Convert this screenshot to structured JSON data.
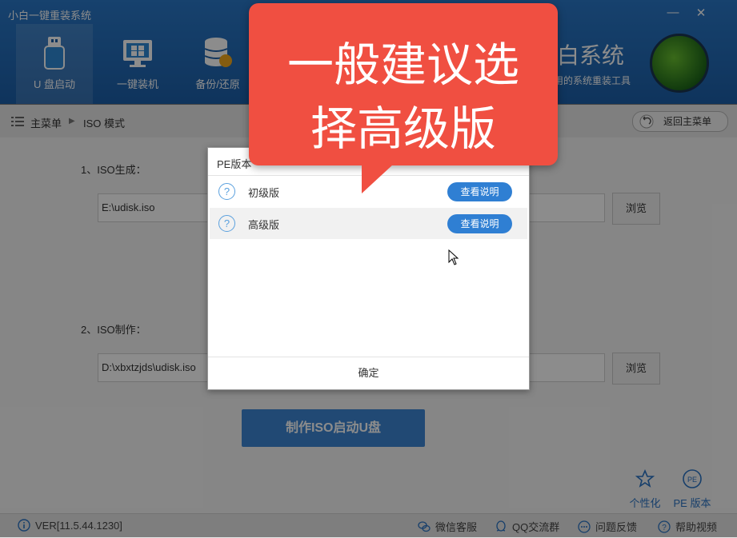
{
  "window": {
    "title": "小白一键重装系统",
    "min_glyph": "—",
    "close_glyph": "✕"
  },
  "nav": [
    {
      "label": "U 盘启动"
    },
    {
      "label": "一键装机"
    },
    {
      "label": "备份/还原"
    }
  ],
  "brand": {
    "name": "白系统",
    "tagline": "用的系统重装工具"
  },
  "breadcrumb": {
    "home": "主菜单",
    "separator": "▶",
    "current": "ISO 模式",
    "back_label": "返回主菜单"
  },
  "main": {
    "section1_label": "1、ISO生成：",
    "iso_output_path": "E:\\udisk.iso",
    "section2_label": "2、ISO制作：",
    "iso_source_path": "D:\\xbxtzjds\\udisk.iso",
    "browse_label": "浏览",
    "make_button": "制作ISO启动U盘"
  },
  "tools": [
    {
      "label": "个性化",
      "icon": "customize-icon"
    },
    {
      "label": "PE 版本",
      "icon": "pe-version-icon"
    }
  ],
  "footer": {
    "version": "VER[11.5.44.1230]",
    "wechat": "微信客服",
    "qq": "QQ交流群",
    "feedback": "问题反馈",
    "help_video": "帮助视频"
  },
  "dialog": {
    "title": "PE版本",
    "options": [
      {
        "name": "初级版",
        "detail": "查看说明"
      },
      {
        "name": "高级版",
        "detail": "查看说明"
      }
    ],
    "confirm": "确定"
  },
  "callout": {
    "line1": "一般建议选",
    "line2": "择高级版"
  },
  "colors": {
    "header_blue": "#1c5fa8",
    "accent_blue": "#2f7fd3",
    "callout_red": "#f04f41"
  }
}
